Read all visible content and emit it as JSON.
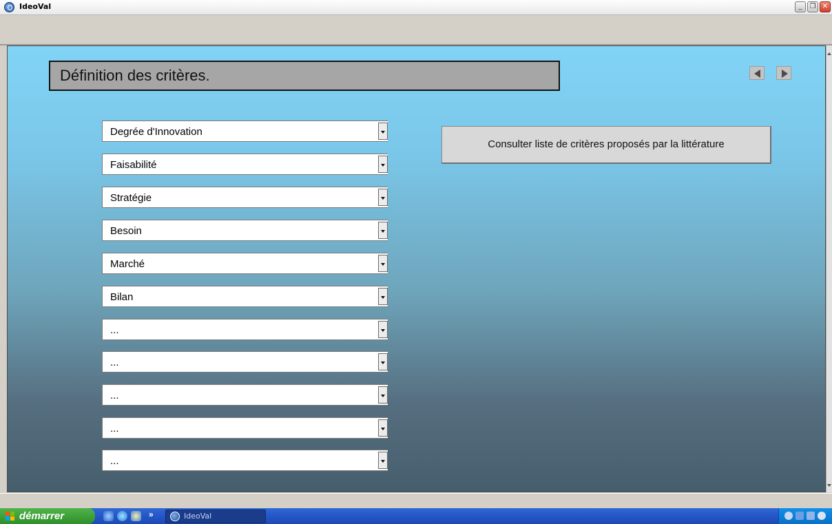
{
  "window": {
    "title": "IdeoVal",
    "controls": {
      "minimize": "_",
      "restore": "❐",
      "close": "✕"
    }
  },
  "page": {
    "section_title": "Définition des critères.",
    "nav": {
      "prev_icon": "triangle-left-icon",
      "next_icon": "triangle-right-icon"
    },
    "criteria": [
      "Degrée d'Innovation",
      "Faisabilité",
      "Stratégie",
      "Besoin",
      "Marché",
      "Bilan",
      "...",
      "...",
      "...",
      "...",
      "..."
    ],
    "consult_button_label": "Consulter liste de critères proposés par la littérature"
  },
  "taskbar": {
    "start_label": "démarrer",
    "quick_launch_more": "»",
    "task_label": "IdeoVal"
  },
  "colors": {
    "content_gradient_top": "#81d4f6",
    "content_gradient_bottom": "#465e6c",
    "title_box": "#a6a6a6",
    "taskbar": "#2456c7",
    "start_button": "#3fa43a"
  }
}
